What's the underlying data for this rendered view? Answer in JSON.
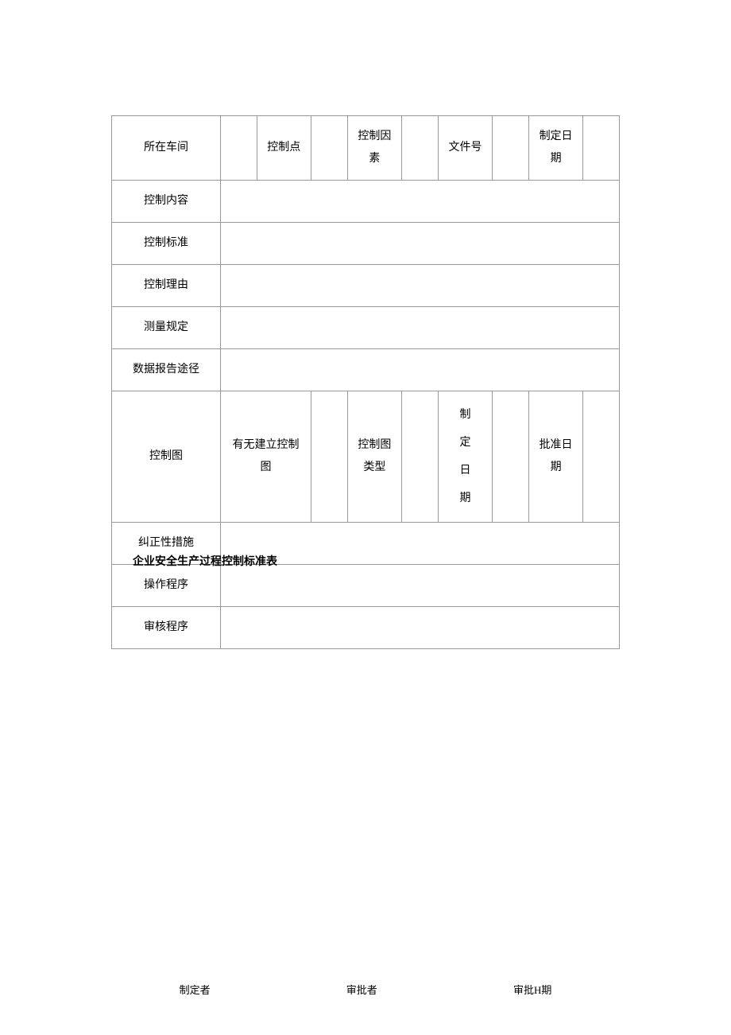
{
  "table": {
    "row1": {
      "workshop_label": "所在车间",
      "control_point_label": "控制点",
      "control_factor_label": "控制因素",
      "doc_number_label": "文件号",
      "formulation_date_label": "制定日期"
    },
    "row2_label": "控制内容",
    "row3_label": "控制标准",
    "row4_label": "控制理由",
    "row5_label": "测量规定",
    "row6_label": "数据报告途径",
    "row7": {
      "control_chart_label": "控制图",
      "has_chart_label": "有无建立控制图",
      "chart_type_label": "控制图类型",
      "formulation_date_label": "制定日期",
      "approval_date_label": "批准日期"
    },
    "row8_label": "纠正性措施",
    "row9_label": "操作程序",
    "row10_label": "审核程序"
  },
  "subtitle": "企业安全生产过程控制标准表",
  "footer": {
    "creator": "制定者",
    "approver": "审批者",
    "approval_date": "审批H期"
  }
}
